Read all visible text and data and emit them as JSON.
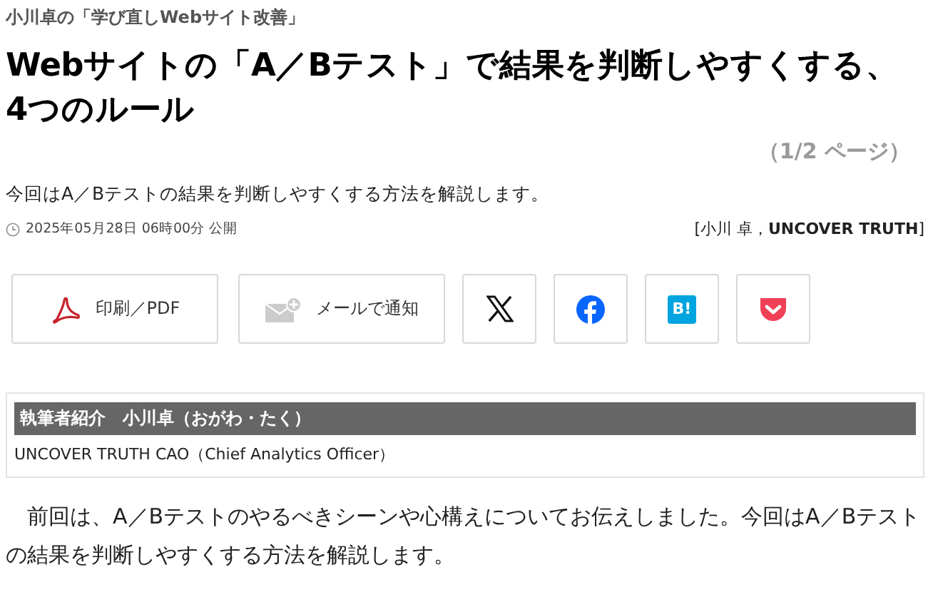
{
  "series": "小川卓の「学び直しWebサイト改善」",
  "title_lines": [
    "Webサイトの「A／Bテスト」で結果を判断しやすくする、",
    "4つのルール"
  ],
  "page_indicator": "（1/2 ページ）",
  "lead": "今回はA／Bテストの結果を判断しやすくする方法を解説します。",
  "date": "2025年05月28日 06時00分 公開",
  "byline": "[小川 卓，**UNCOVER TRUTH**]",
  "actions": [
    {
      "kind": "pdf",
      "label": "印刷／PDF"
    },
    {
      "kind": "mail",
      "label": "メールで通知"
    }
  ],
  "share": [
    {
      "kind": "x"
    },
    {
      "kind": "facebook"
    },
    {
      "kind": "hatena",
      "text": "B!"
    },
    {
      "kind": "pocket"
    }
  ],
  "author_box": {
    "heading": "執筆者紹介　小川卓（おがわ・たく）",
    "text": "UNCOVER TRUTH CAO（Chief Analytics Officer）"
  },
  "body": "前回は、A／Bテストのやるべきシーンや心構えについてお伝えしました。今回はA／Bテストの結果を判断しやすくする方法を解説します。"
}
